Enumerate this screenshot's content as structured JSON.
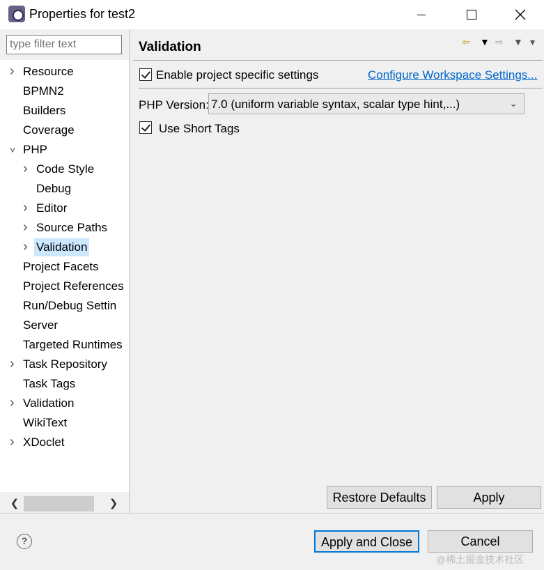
{
  "window": {
    "title": "Properties for test2",
    "controls": [
      "minimize",
      "maximize",
      "close"
    ]
  },
  "filter": {
    "placeholder": "type filter text",
    "value": ""
  },
  "tree": {
    "items": [
      {
        "label": "Resource",
        "level": 0,
        "expander": "collapsed"
      },
      {
        "label": "BPMN2",
        "level": 0,
        "expander": "none"
      },
      {
        "label": "Builders",
        "level": 0,
        "expander": "none"
      },
      {
        "label": "Coverage",
        "level": 0,
        "expander": "none"
      },
      {
        "label": "PHP",
        "level": 0,
        "expander": "expanded"
      },
      {
        "label": "Code Style",
        "level": 1,
        "expander": "collapsed"
      },
      {
        "label": "Debug",
        "level": 1,
        "expander": "none"
      },
      {
        "label": "Editor",
        "level": 1,
        "expander": "collapsed"
      },
      {
        "label": "Source Paths",
        "level": 1,
        "expander": "collapsed"
      },
      {
        "label": "Validation",
        "level": 1,
        "expander": "collapsed",
        "selected": true
      },
      {
        "label": "Project Facets",
        "level": 0,
        "expander": "none"
      },
      {
        "label": "Project References",
        "level": 0,
        "expander": "none"
      },
      {
        "label": "Run/Debug Settin",
        "level": 0,
        "expander": "none"
      },
      {
        "label": "Server",
        "level": 0,
        "expander": "none"
      },
      {
        "label": "Targeted Runtimes",
        "level": 0,
        "expander": "none"
      },
      {
        "label": "Task Repository",
        "level": 0,
        "expander": "collapsed"
      },
      {
        "label": "Task Tags",
        "level": 0,
        "expander": "none"
      },
      {
        "label": "Validation",
        "level": 0,
        "expander": "collapsed"
      },
      {
        "label": "WikiText",
        "level": 0,
        "expander": "none"
      },
      {
        "label": "XDoclet",
        "level": 0,
        "expander": "collapsed"
      }
    ]
  },
  "page": {
    "title": "Validation",
    "nav_icons": [
      "back-arrow-icon",
      "dropdown-icon",
      "forward-arrow-icon",
      "dropdown-icon",
      "view-menu-icon"
    ],
    "enable_specific": {
      "label": "Enable project specific settings",
      "checked": true
    },
    "configure_link": "Configure Workspace Settings...",
    "php_version": {
      "label": "PHP Version:",
      "value": "7.0 (uniform variable syntax, scalar type hint,...)"
    },
    "short_tags": {
      "label": "Use Short Tags",
      "checked": true
    },
    "restore_defaults": "Restore Defaults",
    "apply": "Apply"
  },
  "footer": {
    "help_glyph": "?",
    "apply_and_close": "Apply and Close",
    "cancel": "Cancel"
  },
  "watermark": "@稀土掘金技术社区",
  "colors": {
    "selection": "#cce8ff",
    "link": "#0066cc",
    "default_button_border": "#0078d7"
  }
}
